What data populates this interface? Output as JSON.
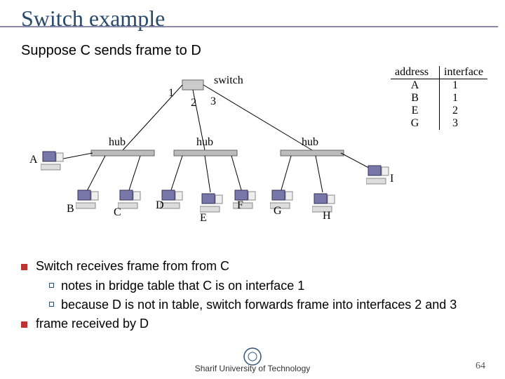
{
  "title": "Switch example",
  "subtitle": "Suppose C sends frame to D",
  "switch_label": "switch",
  "hub_labels": [
    "hub",
    "hub",
    "hub"
  ],
  "port_labels": [
    "1",
    "2",
    "3"
  ],
  "table": {
    "header_addr": "address",
    "header_if": "interface",
    "rows": [
      {
        "addr": "A",
        "if": "1"
      },
      {
        "addr": "B",
        "if": "1"
      },
      {
        "addr": "E",
        "if": "2"
      },
      {
        "addr": "G",
        "if": "3"
      }
    ]
  },
  "hosts": {
    "A": "A",
    "B": "B",
    "C": "C",
    "D": "D",
    "E": "E",
    "F": "F",
    "G": "G",
    "H": "H",
    "I": "I"
  },
  "bullets": {
    "b1": "Switch receives frame from from C",
    "s1": "notes in bridge table that C is on interface 1",
    "s2": "because D is not in table, switch forwards frame into interfaces 2 and 3",
    "b2": "frame received by D"
  },
  "footer": "Sharif University of Technology",
  "page": "64"
}
